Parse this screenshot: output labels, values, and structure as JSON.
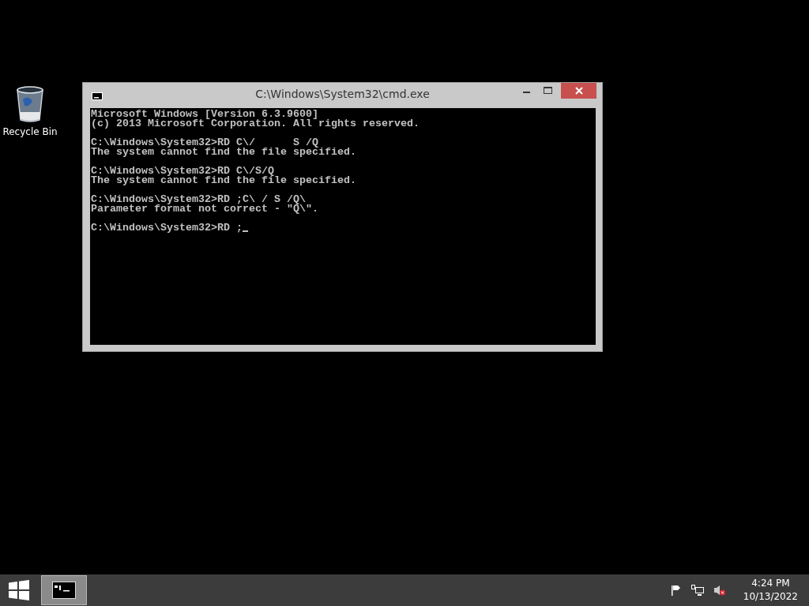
{
  "desktop_icons": [
    {
      "label": "Recycle Bin"
    }
  ],
  "window": {
    "title": "C:\\Windows\\System32\\cmd.exe",
    "console_blocks": [
      [
        "Microsoft Windows [Version 6.3.9600]",
        "(c) 2013 Microsoft Corporation. All rights reserved."
      ],
      [
        "C:\\Windows\\System32>RD C\\/      S /Q",
        "The system cannot find the file specified."
      ],
      [
        "C:\\Windows\\System32>RD C\\/S/Q",
        "The system cannot find the file specified."
      ],
      [
        "C:\\Windows\\System32>RD ;C\\ / S /Q\\",
        "Parameter format not correct - \"Q\\\"."
      ],
      [
        "C:\\Windows\\System32>RD ;"
      ]
    ]
  },
  "taskbar": {
    "apps": [
      {
        "selected": true
      }
    ],
    "clock": {
      "time": "4:24 PM",
      "date": "10/13/2022"
    }
  }
}
